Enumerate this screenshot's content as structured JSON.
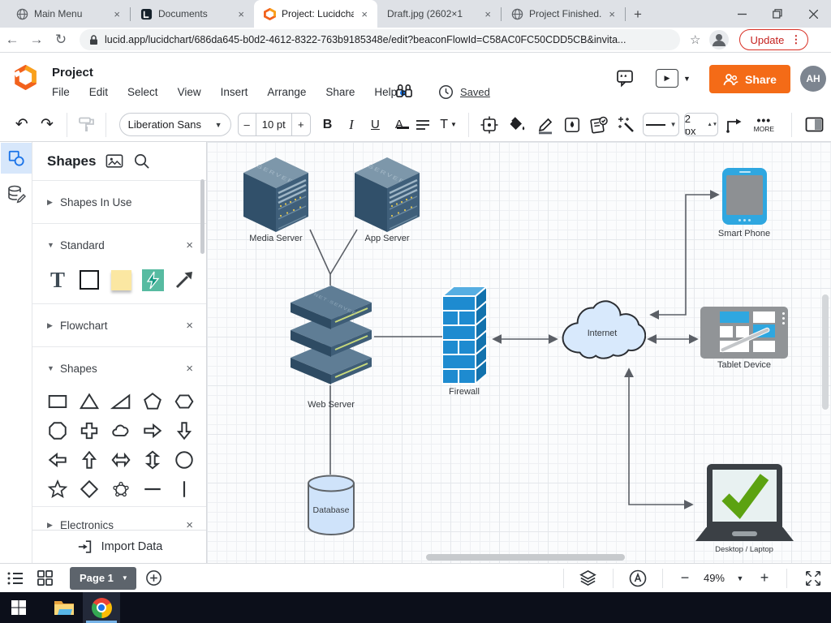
{
  "browser": {
    "tabs": [
      {
        "title": "Main Menu",
        "icon": "globe"
      },
      {
        "title": "Documents",
        "icon": "lucid-docs"
      },
      {
        "title": "Project: Lucidchar",
        "icon": "lucid"
      },
      {
        "title": "Draft.jpg (2602×1",
        "icon": "none"
      },
      {
        "title": "Project Finished.jp",
        "icon": "globe"
      }
    ],
    "url": "lucid.app/lucidchart/686da645-b0d2-4612-8322-763b9185348e/edit?beaconFlowId=C58AC0FC50CDD5CB&invita...",
    "update_label": "Update"
  },
  "header": {
    "title": "Project",
    "menus": [
      {
        "label": "File"
      },
      {
        "label": "Edit"
      },
      {
        "label": "Select"
      },
      {
        "label": "View"
      },
      {
        "label": "Insert"
      },
      {
        "label": "Arrange"
      },
      {
        "label": "Share"
      },
      {
        "label": "Help"
      }
    ],
    "saved_label": "Saved",
    "share_button": "Share",
    "avatar_initials": "AH"
  },
  "toolbar": {
    "font_family_label": "Liberation Sans",
    "decrease_label": "–",
    "font_size_label": "10 pt",
    "increase_label": "+",
    "bold_label": "B",
    "italic_label": "I",
    "underline_label": "U",
    "text_color_label": "A",
    "text_style_label": "T",
    "line_width_label": "2 px",
    "more_label": "MORE"
  },
  "shapes_panel": {
    "title": "Shapes",
    "sections": {
      "in_use": "Shapes In Use",
      "standard": "Standard",
      "flowchart": "Flowchart",
      "shapes": "Shapes",
      "electronics": "Electronics"
    },
    "text_tool_glyph": "T",
    "import_label": "Import Data"
  },
  "canvas": {
    "server_top_text": "SERVER",
    "nodes": {
      "media_server": "Media Server",
      "app_server": "App Server",
      "smart_phone": "Smart Phone",
      "web_server": "Web Server",
      "firewall": "Firewall",
      "internet": "Internet",
      "tablet": "Tablet Device",
      "database": "Database",
      "desktop": "Desktop / Laptop"
    }
  },
  "bottom_bar": {
    "page_label": "Page 1",
    "zoom_level": "49%"
  },
  "colors": {
    "lucid_orange": "#f2621d",
    "share_orange": "#f46b17",
    "firewall_blue": "#1e8bd0",
    "device_blue": "#2fa7e0",
    "cloud_fill": "#d8e9fc",
    "database_fill": "#cfe3fa",
    "check_green": "#5ca211",
    "update_red": "#c5221f",
    "help_dot_blue": "#1071e5"
  }
}
